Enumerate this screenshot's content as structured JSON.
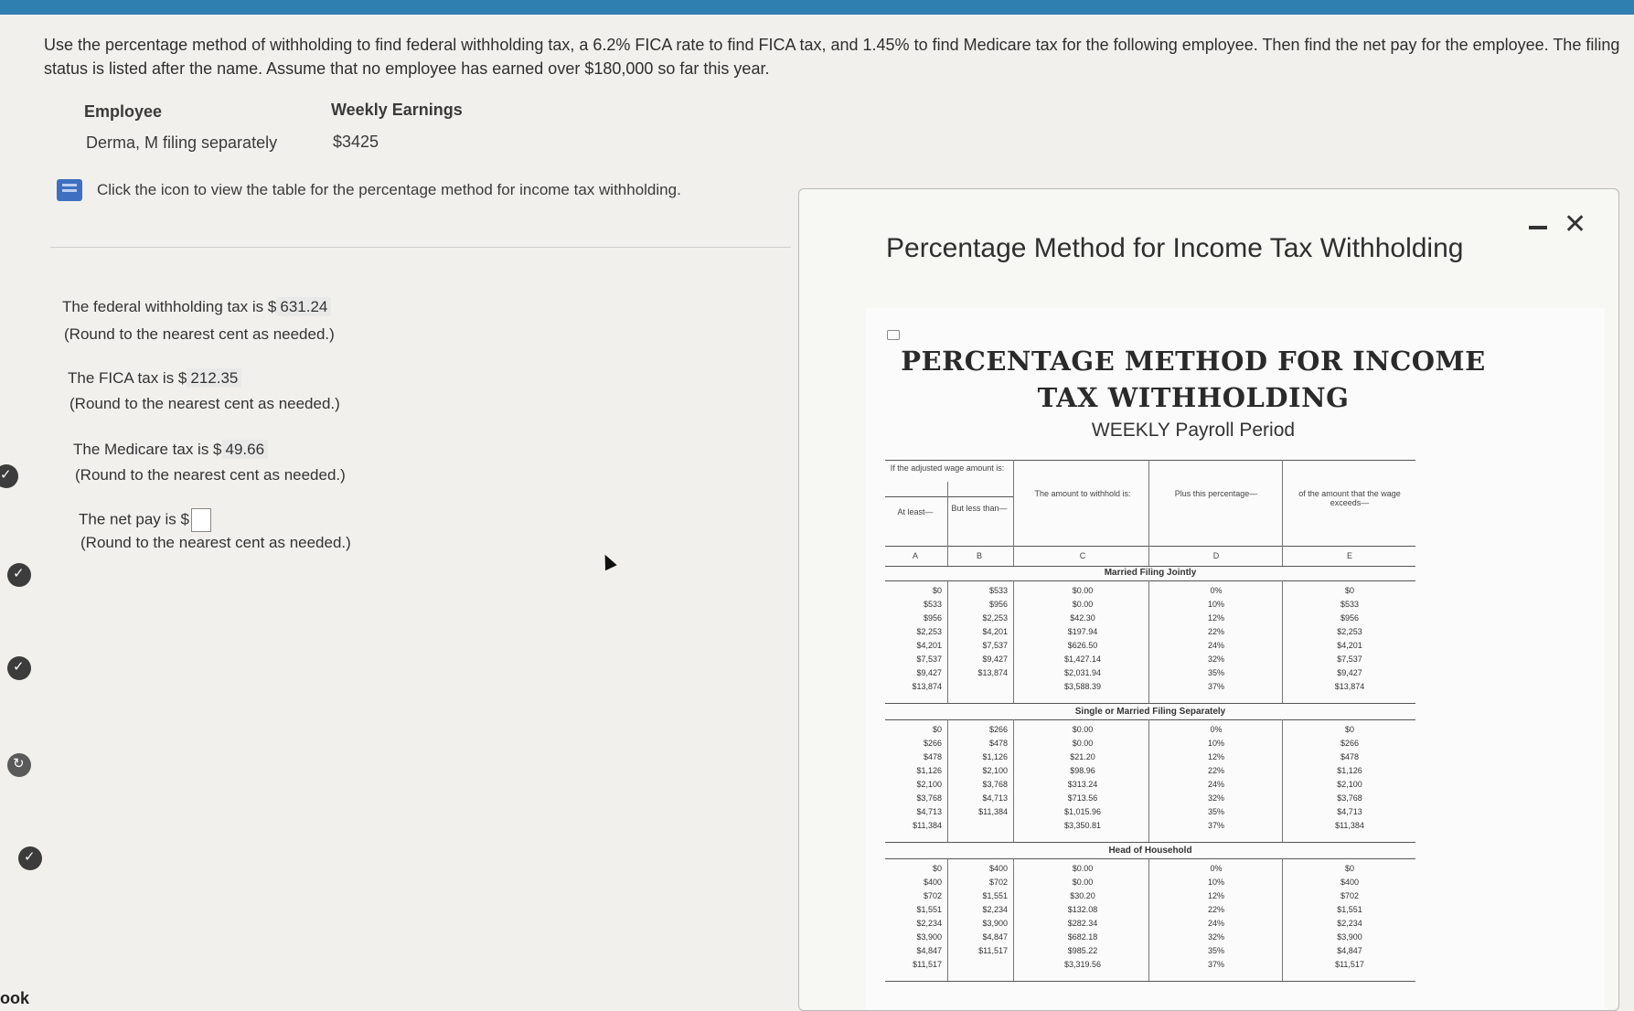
{
  "problem": {
    "text": "Use the percentage method of withholding to find federal withholding tax, a 6.2% FICA rate to find FICA tax, and 1.45% to find Medicare tax for the following employee. Then find the net pay for the employee. The filing status is listed after the name. Assume that no employee has earned over $180,000 so far this year."
  },
  "employee_table": {
    "header_employee": "Employee",
    "header_earnings": "Weekly Earnings",
    "employee": "Derma, M filing separately",
    "earnings": "$3425"
  },
  "hint": "Click the icon to view the table for the percentage method for income tax withholding.",
  "questions": {
    "fwt_prefix": "The federal withholding tax is $",
    "fwt_value": "631.24",
    "round1": "(Round to the nearest cent as needed.)",
    "fica_prefix": "The FICA tax is $",
    "fica_value": "212.35",
    "round2": "(Round to the nearest cent as needed.)",
    "med_prefix": "The Medicare tax is $",
    "med_value": "49.66",
    "round3": "(Round to the nearest cent as needed.)",
    "net_prefix": "The net pay is $",
    "round4": "(Round to the nearest cent as needed.)"
  },
  "bottom_text": "ook",
  "popup": {
    "title": "Percentage Method for Income Tax Withholding",
    "doc_title_line1": "PERCENTAGE METHOD FOR INCOME",
    "doc_title_line2": "TAX WITHHOLDING",
    "doc_subtitle": "WEEKLY Payroll Period",
    "headers": {
      "if_adjusted": "If the adjusted wage amount is:",
      "at_least": "At least—",
      "but_less": "But less than—",
      "amount": "The amount to withhold is:",
      "plus": "Plus this percentage—",
      "of_amount": "of the amount that the wage exceeds—",
      "col_a": "A",
      "col_b": "B",
      "col_c": "C",
      "col_d": "D",
      "col_e": "E"
    },
    "sections": [
      {
        "name": "Married Filing Jointly",
        "at_least": [
          "$0",
          "$533",
          "$956",
          "$2,253",
          "$4,201",
          "$7,537",
          "$9,427",
          "$13,874"
        ],
        "but_less": [
          "$533",
          "$956",
          "$2,253",
          "$4,201",
          "$7,537",
          "$9,427",
          "$13,874",
          ""
        ],
        "amount": [
          "$0.00",
          "$0.00",
          "$42.30",
          "$197.94",
          "$626.50",
          "$1,427.14",
          "$2,031.94",
          "$3,588.39"
        ],
        "percent": [
          "0%",
          "10%",
          "12%",
          "22%",
          "24%",
          "32%",
          "35%",
          "37%"
        ],
        "exceeds": [
          "$0",
          "$533",
          "$956",
          "$2,253",
          "$4,201",
          "$7,537",
          "$9,427",
          "$13,874"
        ]
      },
      {
        "name": "Single or Married Filing Separately",
        "at_least": [
          "$0",
          "$266",
          "$478",
          "$1,126",
          "$2,100",
          "$3,768",
          "$4,713",
          "$11,384"
        ],
        "but_less": [
          "$266",
          "$478",
          "$1,126",
          "$2,100",
          "$3,768",
          "$4,713",
          "$11,384",
          ""
        ],
        "amount": [
          "$0.00",
          "$0.00",
          "$21.20",
          "$98.96",
          "$313.24",
          "$713.56",
          "$1,015.96",
          "$3,350.81"
        ],
        "percent": [
          "0%",
          "10%",
          "12%",
          "22%",
          "24%",
          "32%",
          "35%",
          "37%"
        ],
        "exceeds": [
          "$0",
          "$266",
          "$478",
          "$1,126",
          "$2,100",
          "$3,768",
          "$4,713",
          "$11,384"
        ]
      },
      {
        "name": "Head of Household",
        "at_least": [
          "$0",
          "$400",
          "$702",
          "$1,551",
          "$2,234",
          "$3,900",
          "$4,847",
          "$11,517"
        ],
        "but_less": [
          "$400",
          "$702",
          "$1,551",
          "$2,234",
          "$3,900",
          "$4,847",
          "$11,517",
          ""
        ],
        "amount": [
          "$0.00",
          "$0.00",
          "$30.20",
          "$132.08",
          "$282.34",
          "$682.18",
          "$985.22",
          "$3,319.56"
        ],
        "percent": [
          "0%",
          "10%",
          "12%",
          "22%",
          "24%",
          "32%",
          "35%",
          "37%"
        ],
        "exceeds": [
          "$0",
          "$400",
          "$702",
          "$1,551",
          "$2,234",
          "$3,900",
          "$4,847",
          "$11,517"
        ]
      }
    ]
  },
  "colors": {
    "topbar": "#2f7fb0",
    "hint_icon": "#3f6fc0"
  }
}
